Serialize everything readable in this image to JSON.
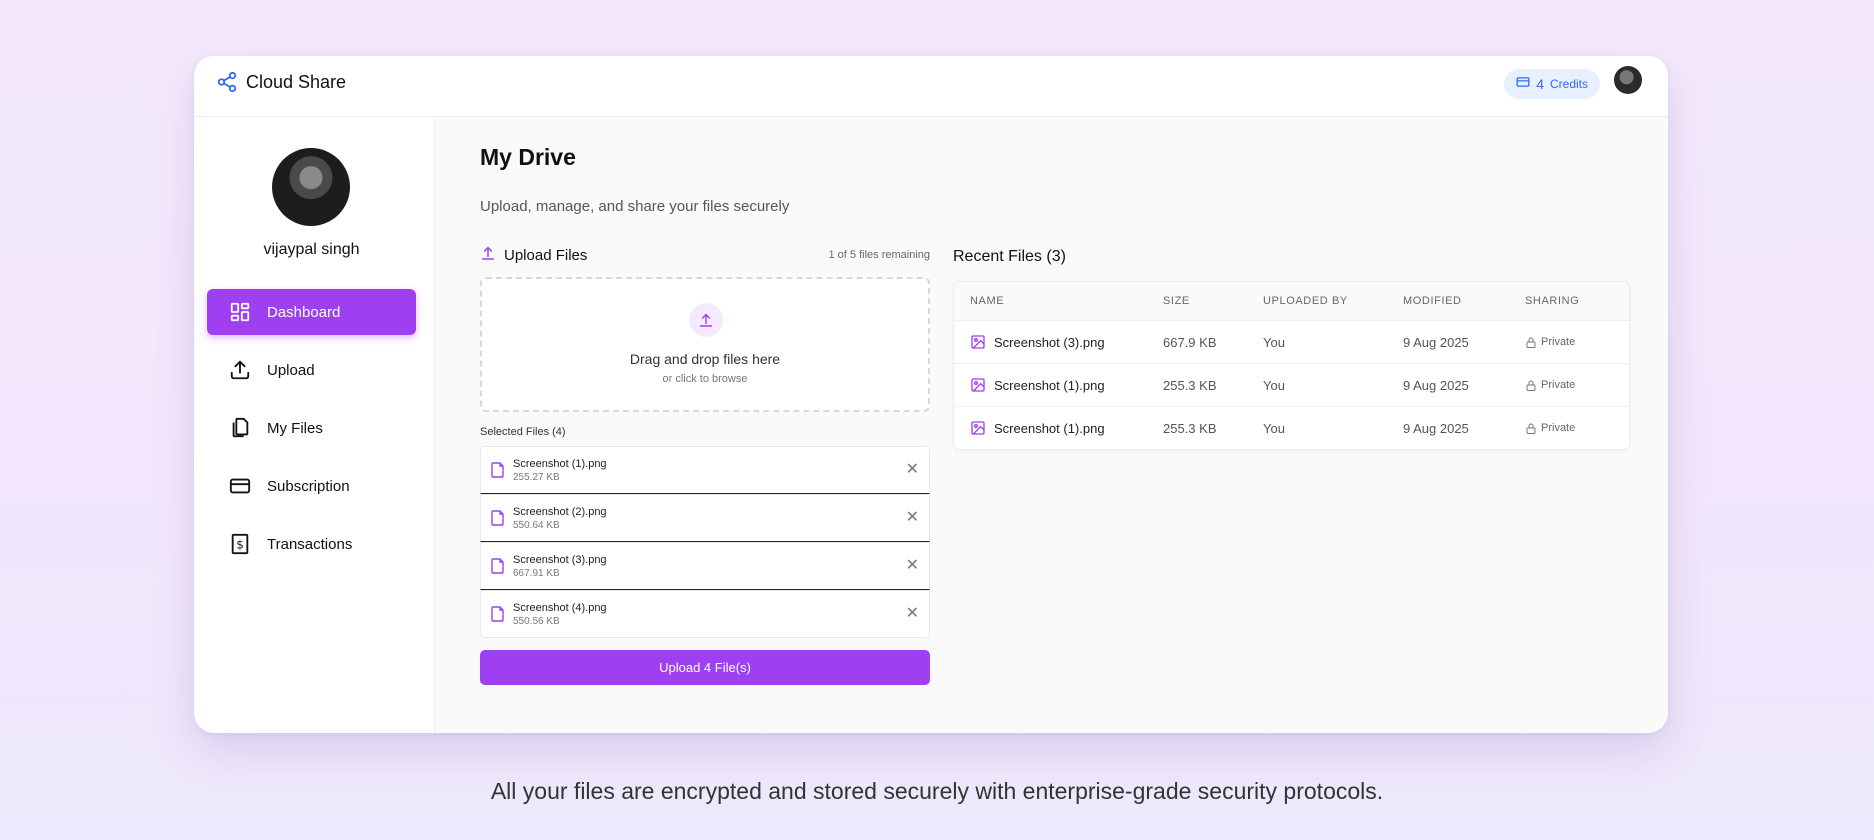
{
  "app": {
    "name": "Cloud Share",
    "credits_count": "4",
    "credits_label": "Credits"
  },
  "user": {
    "name": "vijaypal singh"
  },
  "sidebar": {
    "items": [
      {
        "label": "Dashboard",
        "icon": "dashboard-icon",
        "active": true
      },
      {
        "label": "Upload",
        "icon": "upload-icon"
      },
      {
        "label": "My Files",
        "icon": "files-icon"
      },
      {
        "label": "Subscription",
        "icon": "card-icon"
      },
      {
        "label": "Transactions",
        "icon": "dollar-receipt-icon"
      }
    ]
  },
  "main": {
    "title": "My Drive",
    "subtitle": "Upload, manage, and share your files securely"
  },
  "upload": {
    "title": "Upload Files",
    "remaining": "1 of 5 files remaining",
    "dropzone_title": "Drag and drop files here",
    "dropzone_sub": "or click to browse",
    "selected_label": "Selected Files (4)",
    "files": [
      {
        "name": "Screenshot (1).png",
        "size": "255.27 KB"
      },
      {
        "name": "Screenshot (2).png",
        "size": "550.64 KB"
      },
      {
        "name": "Screenshot (3).png",
        "size": "667.91 KB"
      },
      {
        "name": "Screenshot (4).png",
        "size": "550.56 KB"
      }
    ],
    "button_label": "Upload 4 File(s)"
  },
  "recent": {
    "title": "Recent Files (3)",
    "columns": [
      "NAME",
      "SIZE",
      "UPLOADED BY",
      "MODIFIED",
      "SHARING"
    ],
    "rows": [
      {
        "name": "Screenshot (3).png",
        "size": "667.9 KB",
        "uploaded_by": "You",
        "modified": "9 Aug 2025",
        "sharing": "Private"
      },
      {
        "name": "Screenshot (1).png",
        "size": "255.3 KB",
        "uploaded_by": "You",
        "modified": "9 Aug 2025",
        "sharing": "Private"
      },
      {
        "name": "Screenshot (1).png",
        "size": "255.3 KB",
        "uploaded_by": "You",
        "modified": "9 Aug 2025",
        "sharing": "Private"
      }
    ]
  },
  "footer": {
    "text": "All your files are encrypted and stored securely with enterprise-grade security protocols."
  },
  "colors": {
    "accent": "#9f3ff2",
    "credits_blue": "#2f6bef",
    "background": "#f3e9fb"
  }
}
